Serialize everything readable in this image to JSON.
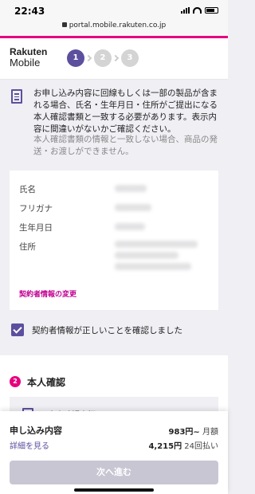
{
  "status": {
    "time": "22:43"
  },
  "browser": {
    "url": "portal.mobile.rakuten.co.jp"
  },
  "header": {
    "brand_line1": "Rakuten",
    "brand_line2": "Mobile",
    "steps": [
      "1",
      "2",
      "3"
    ],
    "active_step": 1
  },
  "notice": {
    "text": "お申し込み内容に回線もしくは一部の製品が含まれる場合、氏名・生年月日・住所がご提出になる本人確認書類と一致する必要があります。表示内容に間違いがないかご確認ください。",
    "subtext": "本人確認書類の情報と一致しない場合、商品の発送・お渡しができません。"
  },
  "info": {
    "fields": [
      "氏名",
      "フリガナ",
      "生年月日",
      "住所"
    ],
    "change_link": "契約者情報の変更"
  },
  "confirm": {
    "label": "契約者情報が正しいことを確認しました",
    "checked": true
  },
  "identity": {
    "number": "2",
    "title": "本人確認",
    "item_label": "本人確認書類について"
  },
  "summary": {
    "title": "申し込み内容",
    "details_link": "詳細を見る",
    "monthly_amount": "983円~",
    "monthly_unit": "月額",
    "installment_amount": "4,215円",
    "installment_unit": "24回払い",
    "next_button": "次へ進む"
  },
  "colors": {
    "accent": "#e6007e",
    "primary": "#5c4f9e",
    "link": "#c20091",
    "disabled_button": "#c9c6d4"
  }
}
